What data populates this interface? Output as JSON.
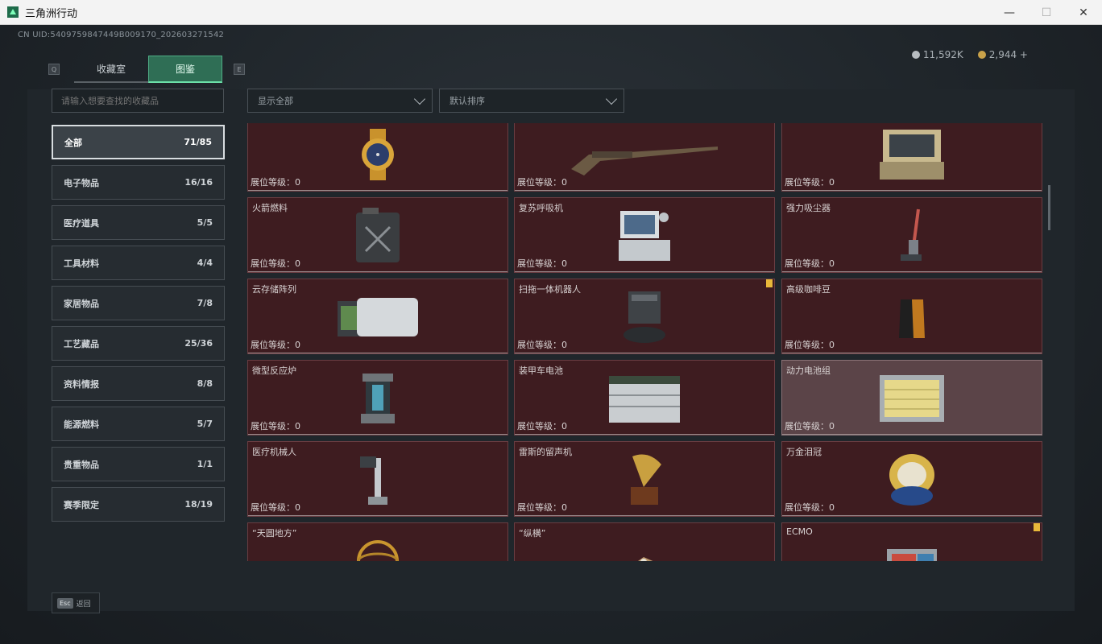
{
  "window": {
    "title": "三角洲行动",
    "minimize": "—",
    "maximize": "☐",
    "close": "✕"
  },
  "header": {
    "uid": "CN UID:5409759847449B009170_202603271542",
    "tab_key_left": "Q",
    "tab_key_right": "E",
    "tabs": [
      {
        "label": "收藏室",
        "active": false
      },
      {
        "label": "图鉴",
        "active": true
      }
    ],
    "currency": [
      {
        "icon": "silver-coin-icon",
        "value": "11,592K",
        "color": "#b7bcc0"
      },
      {
        "icon": "gold-coin-icon",
        "value": "2,944 +",
        "color": "#c9a24a"
      }
    ]
  },
  "search": {
    "placeholder": "请输入想要查找的收藏品"
  },
  "filters": {
    "display": "显示全部",
    "sort": "默认排序"
  },
  "categories": [
    {
      "label": "全部",
      "count": "71/85",
      "active": true
    },
    {
      "label": "电子物品",
      "count": "16/16"
    },
    {
      "label": "医疗道具",
      "count": "5/5"
    },
    {
      "label": "工具材料",
      "count": "4/4"
    },
    {
      "label": "家居物品",
      "count": "7/8"
    },
    {
      "label": "工艺藏品",
      "count": "25/36"
    },
    {
      "label": "资料情报",
      "count": "8/8"
    },
    {
      "label": "能源燃料",
      "count": "5/7"
    },
    {
      "label": "贵重物品",
      "count": "1/1"
    },
    {
      "label": "赛季限定",
      "count": "18/19"
    }
  ],
  "level_label": "展位等级：0",
  "items": [
    {
      "name": "",
      "icon": "gold-watch-icon"
    },
    {
      "name": "",
      "icon": "musket-icon"
    },
    {
      "name": "",
      "icon": "field-terminal-icon"
    },
    {
      "name": "火箭燃料",
      "icon": "fuel-canister-icon"
    },
    {
      "name": "复苏呼吸机",
      "icon": "ventilator-icon"
    },
    {
      "name": "强力吸尘器",
      "icon": "vacuum-cleaner-icon"
    },
    {
      "name": "云存储阵列",
      "icon": "storage-array-icon"
    },
    {
      "name": "扫拖一体机器人",
      "icon": "robot-vacuum-icon",
      "flag": true
    },
    {
      "name": "高级咖啡豆",
      "icon": "coffee-bag-icon"
    },
    {
      "name": "微型反应炉",
      "icon": "reactor-icon"
    },
    {
      "name": "装甲车电池",
      "icon": "vehicle-battery-icon"
    },
    {
      "name": "动力电池组",
      "icon": "battery-pack-icon",
      "light": true
    },
    {
      "name": "医疗机械人",
      "icon": "medical-robot-icon"
    },
    {
      "name": "雷斯的留声机",
      "icon": "gramophone-icon"
    },
    {
      "name": "万金泪冠",
      "icon": "jeweled-egg-icon"
    },
    {
      "name": "“天圆地方”",
      "icon": "armillary-sphere-icon"
    },
    {
      "name": "“纵横”",
      "icon": "chess-board-icon"
    },
    {
      "name": "ECMO",
      "icon": "ecmo-case-icon",
      "flag": true
    }
  ],
  "footer": {
    "esc_key": "Esc",
    "back_label": "返回"
  }
}
